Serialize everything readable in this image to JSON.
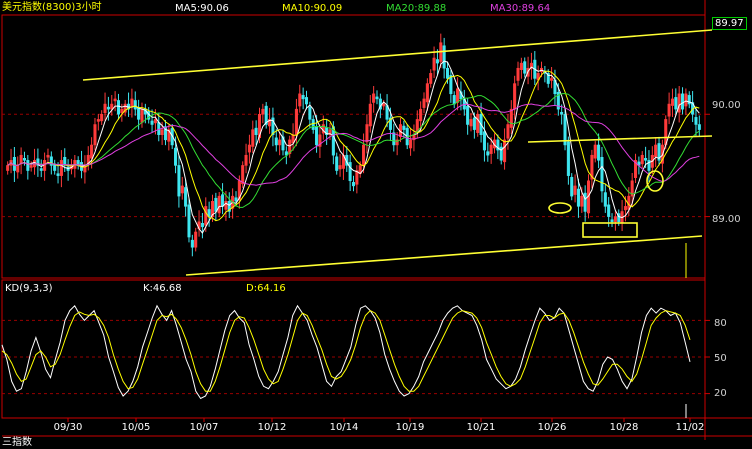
{
  "header": {
    "title": "美元指数(8300)3小时",
    "ma5": "MA5:90.06",
    "ma10": "MA10:90.09",
    "ma20": "MA20:89.88",
    "ma30": "MA30:89.64"
  },
  "kd": {
    "label": "KD(9,3,3)",
    "k": "K:46.68",
    "d": "D:64.16"
  },
  "colors": {
    "up": "#ff3b3b",
    "down": "#3ee6f0",
    "ma5": "#ffffff",
    "ma10": "#ffff00",
    "ma20": "#33dd33",
    "ma30": "#e040e0",
    "trend": "#ffff33",
    "grid": "#990000",
    "frame": "#cc0000"
  },
  "bottom_text": "三指数",
  "chart_data": [
    {
      "type": "candlestick",
      "title": "美元指数(8300)3小时",
      "y_ticks": [
        "89.00",
        "90.00"
      ],
      "y_ticks_values": [
        89.0,
        90.0
      ],
      "last_price_label": "89.97",
      "ylim": [
        88.4,
        90.97
      ],
      "x_tick_labels": [
        "09/30",
        "10/05",
        "10/07",
        "10/12",
        "10/14",
        "10/19",
        "10/21",
        "10/26",
        "10/28",
        "11/02"
      ],
      "close": [
        89.5,
        89.55,
        89.45,
        89.5,
        89.6,
        89.55,
        89.45,
        89.5,
        89.55,
        89.5,
        89.45,
        89.55,
        89.6,
        89.5,
        89.45,
        89.4,
        89.55,
        89.5,
        89.45,
        89.5,
        89.55,
        89.5,
        89.45,
        89.5,
        89.6,
        89.7,
        89.9,
        89.95,
        90.0,
        90.1,
        90.05,
        90.1,
        90.15,
        90.0,
        90.05,
        90.1,
        90.05,
        90.15,
        90.05,
        89.95,
        90.05,
        90.0,
        89.95,
        89.9,
        89.95,
        89.8,
        89.85,
        89.75,
        89.85,
        89.7,
        89.5,
        89.2,
        89.3,
        89.1,
        88.8,
        88.7,
        88.85,
        88.95,
        88.9,
        89.1,
        89.0,
        89.15,
        89.05,
        89.2,
        89.1,
        89.15,
        89.05,
        89.2,
        89.15,
        89.35,
        89.5,
        89.6,
        89.7,
        89.85,
        89.8,
        90.0,
        90.05,
        89.9,
        89.95,
        89.8,
        89.7,
        89.75,
        89.65,
        89.6,
        89.75,
        89.8,
        90.05,
        90.2,
        90.15,
        90.1,
        89.95,
        89.85,
        89.7,
        89.8,
        89.9,
        89.8,
        89.85,
        89.6,
        89.45,
        89.5,
        89.6,
        89.5,
        89.35,
        89.3,
        89.45,
        89.5,
        89.7,
        89.9,
        90.1,
        90.2,
        90.15,
        90.05,
        90.1,
        89.95,
        89.85,
        89.7,
        89.75,
        89.9,
        89.85,
        89.7,
        89.75,
        89.8,
        89.95,
        90.05,
        90.15,
        90.3,
        90.4,
        90.55,
        90.5,
        90.7,
        90.45,
        90.35,
        90.2,
        90.1,
        90.25,
        90.15,
        90.05,
        89.9,
        89.95,
        89.85,
        90.0,
        89.8,
        89.65,
        89.6,
        89.7,
        89.75,
        89.65,
        89.55,
        89.75,
        89.9,
        90.05,
        90.3,
        90.45,
        90.5,
        90.4,
        90.45,
        90.5,
        90.35,
        90.4,
        90.45,
        90.4,
        90.3,
        90.35,
        90.2,
        90.05,
        90.0,
        89.7,
        89.4,
        89.2,
        89.3,
        89.1,
        89.2,
        89.05,
        89.35,
        89.6,
        89.7,
        89.55,
        89.25,
        89.1,
        89.0,
        88.95,
        89.0,
        88.95,
        89.05,
        89.1,
        89.2,
        89.35,
        89.55,
        89.5,
        89.6,
        89.55,
        89.45,
        89.6,
        89.7,
        89.55,
        89.7,
        89.95,
        90.1,
        90.15,
        90.05,
        90.2,
        90.05,
        90.2,
        90.1,
        90.0,
        89.9,
        89.85
      ]
    },
    {
      "type": "line",
      "title": "KD(9,3,3)",
      "series": [
        {
          "name": "K",
          "values": [
            60,
            48,
            30,
            22,
            24,
            38,
            55,
            66,
            54,
            40,
            33,
            48,
            62,
            80,
            88,
            92,
            85,
            80,
            84,
            88,
            78,
            68,
            50,
            38,
            25,
            18,
            22,
            30,
            42,
            58,
            70,
            82,
            92,
            85,
            80,
            88,
            76,
            62,
            48,
            38,
            22,
            16,
            18,
            26,
            40,
            56,
            72,
            84,
            88,
            82,
            78,
            60,
            48,
            34,
            26,
            24,
            30,
            38,
            52,
            66,
            84,
            92,
            86,
            80,
            68,
            58,
            44,
            30,
            26,
            34,
            38,
            48,
            58,
            76,
            90,
            92,
            88,
            82,
            70,
            52,
            40,
            30,
            22,
            18,
            20,
            26,
            34,
            46,
            54,
            62,
            70,
            80,
            86,
            90,
            92,
            88,
            86,
            84,
            76,
            64,
            48,
            40,
            32,
            28,
            24,
            26,
            32,
            42,
            56,
            68,
            80,
            90,
            86,
            80,
            82,
            90,
            86,
            72,
            58,
            44,
            30,
            24,
            22,
            30,
            44,
            50,
            48,
            40,
            30,
            24,
            32,
            50,
            70,
            84,
            90,
            86,
            90,
            88,
            84,
            86,
            78,
            62,
            46
          ]
        },
        {
          "name": "D",
          "values": [
            55,
            52,
            45,
            36,
            30,
            32,
            42,
            52,
            55,
            50,
            42,
            44,
            52,
            64,
            75,
            84,
            87,
            85,
            84,
            85,
            82,
            76,
            66,
            52,
            40,
            30,
            24,
            25,
            32,
            44,
            56,
            68,
            80,
            84,
            83,
            85,
            81,
            74,
            64,
            52,
            38,
            28,
            22,
            22,
            30,
            42,
            56,
            70,
            80,
            83,
            82,
            74,
            64,
            52,
            40,
            32,
            28,
            30,
            40,
            52,
            66,
            80,
            86,
            84,
            76,
            66,
            56,
            44,
            34,
            32,
            34,
            40,
            48,
            60,
            74,
            84,
            88,
            86,
            80,
            68,
            56,
            44,
            34,
            26,
            22,
            22,
            26,
            34,
            42,
            50,
            58,
            66,
            74,
            82,
            86,
            88,
            87,
            86,
            82,
            74,
            62,
            52,
            42,
            34,
            28,
            26,
            28,
            32,
            42,
            54,
            66,
            78,
            84,
            84,
            82,
            85,
            86,
            80,
            70,
            58,
            46,
            36,
            28,
            27,
            32,
            38,
            44,
            44,
            40,
            34,
            30,
            36,
            48,
            62,
            76,
            82,
            86,
            88,
            87,
            86,
            84,
            76,
            64
          ]
        }
      ],
      "y_ticks": [
        "80",
        "50",
        "20"
      ],
      "y_ticks_values": [
        80,
        50,
        20
      ],
      "ylim": [
        0,
        100
      ]
    }
  ]
}
